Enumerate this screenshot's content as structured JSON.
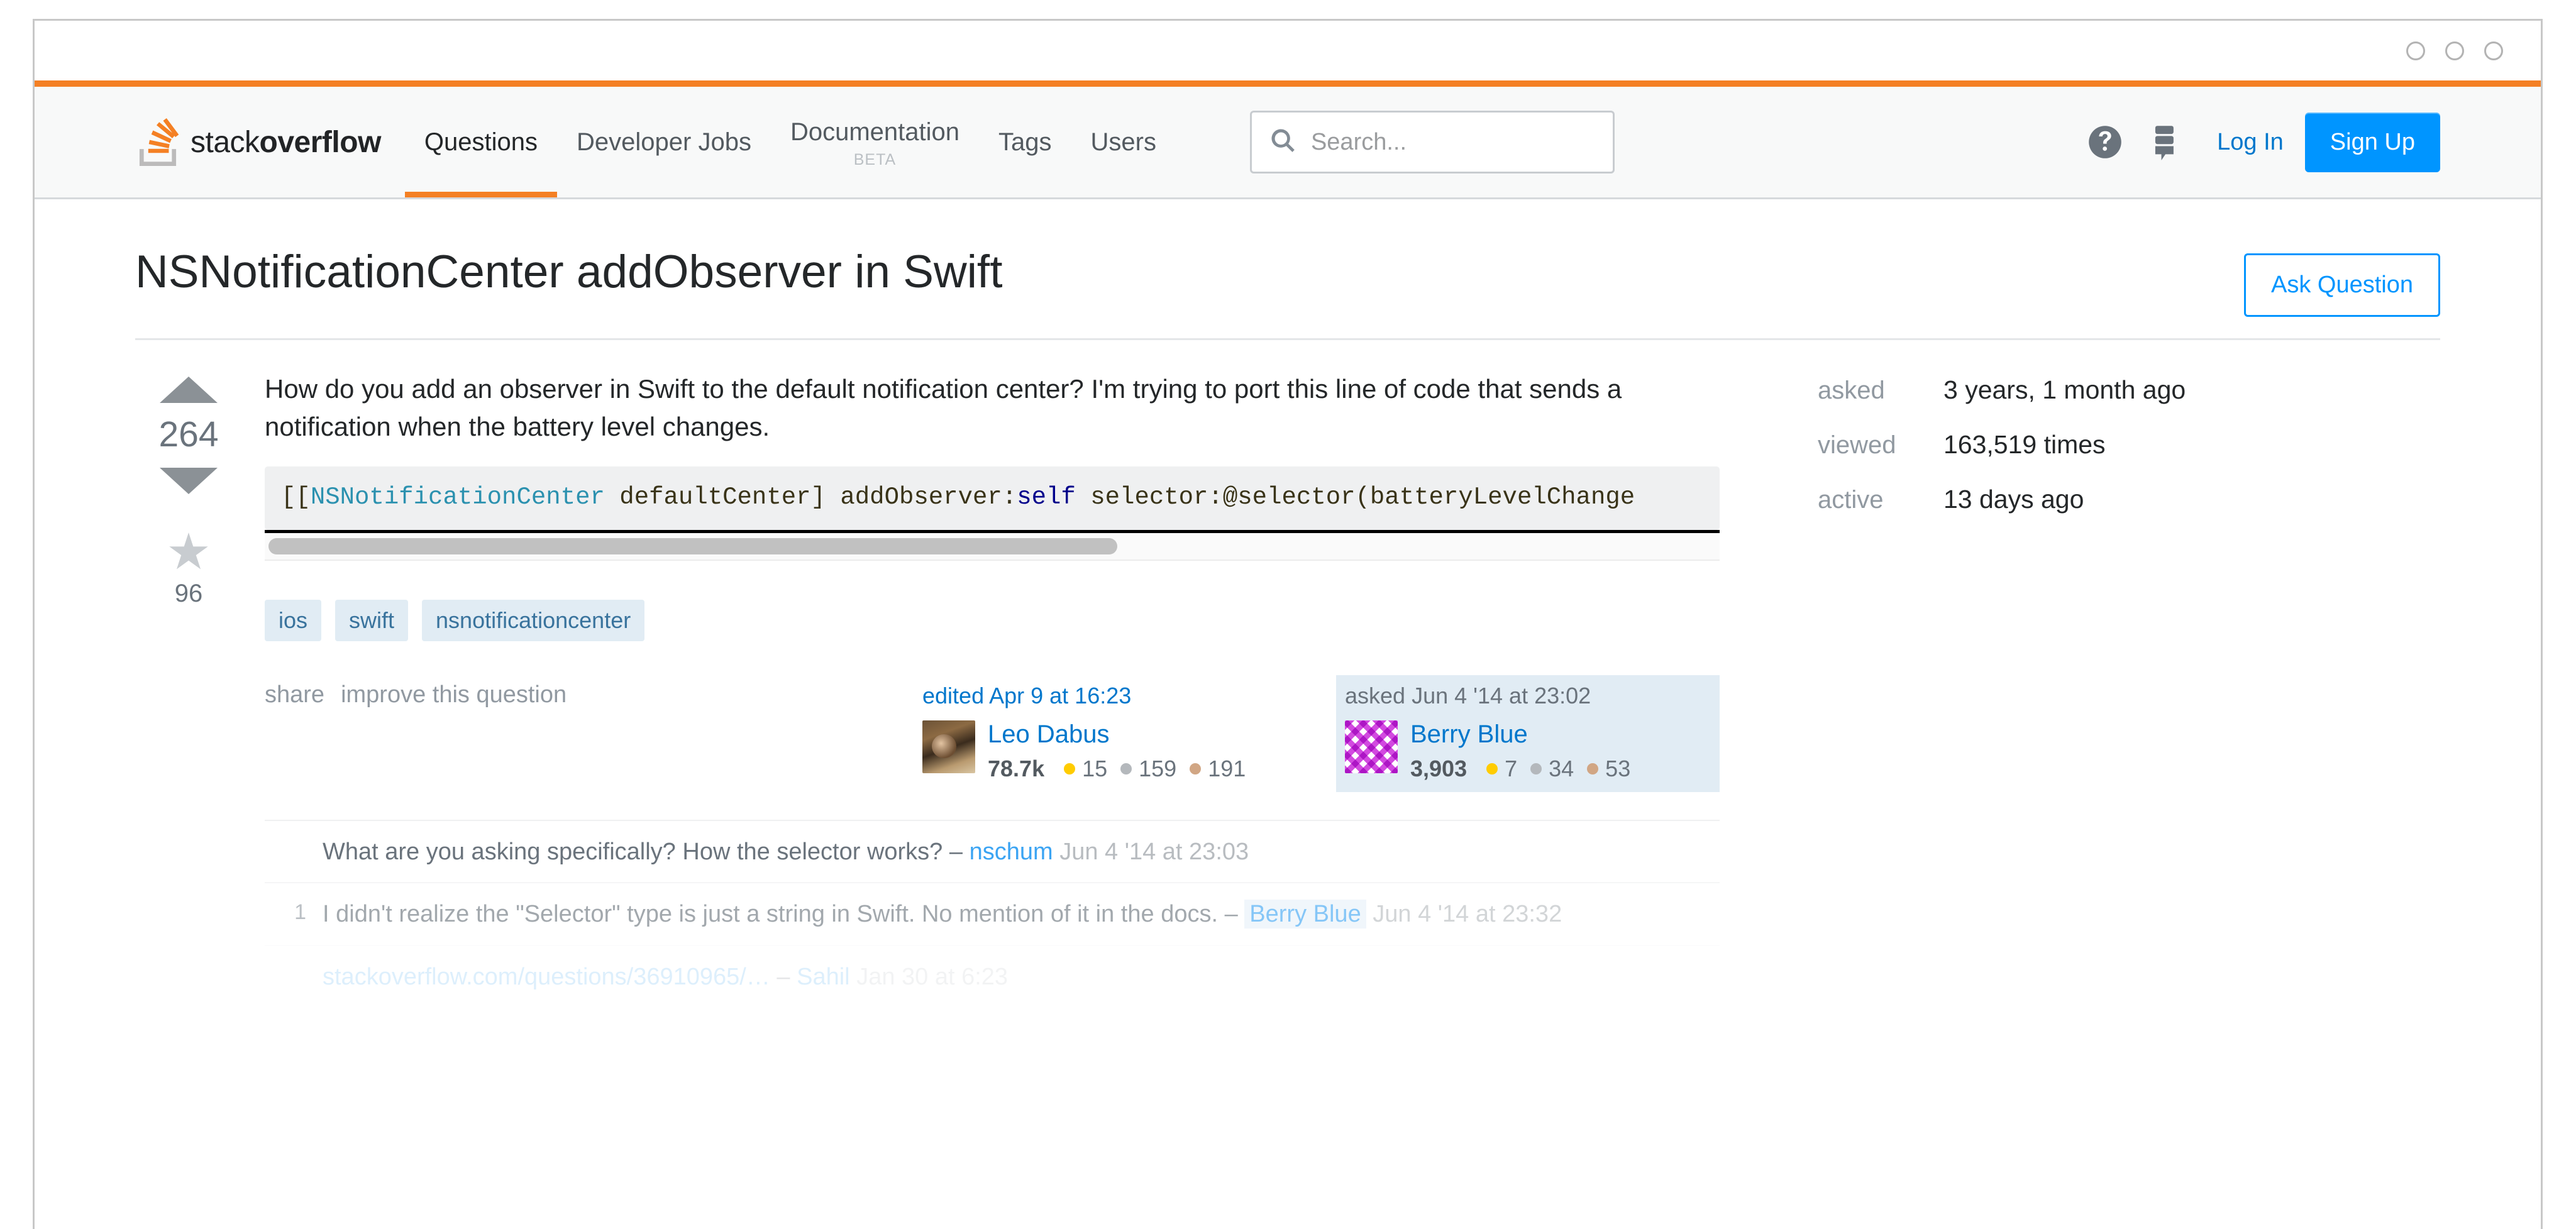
{
  "window": {
    "controls": [
      "minimize-dot",
      "maximize-dot",
      "close-dot"
    ]
  },
  "header": {
    "logo_text_light": "stack",
    "logo_text_bold": "overflow",
    "nav": [
      {
        "label": "Questions",
        "sublabel": "",
        "active": true
      },
      {
        "label": "Developer Jobs",
        "sublabel": "",
        "active": false
      },
      {
        "label": "Documentation",
        "sublabel": "BETA",
        "active": false
      },
      {
        "label": "Tags",
        "sublabel": "",
        "active": false
      },
      {
        "label": "Users",
        "sublabel": "",
        "active": false
      }
    ],
    "search": {
      "placeholder": "Search...",
      "value": ""
    },
    "help_icon": "help-circle-icon",
    "inbox_icon": "achievements-icon",
    "login_label": "Log In",
    "signup_label": "Sign Up",
    "accent_color": "#f48024",
    "signup_color": "#0095ff"
  },
  "question": {
    "title": "NSNotificationCenter addObserver in Swift",
    "ask_question_label": "Ask Question",
    "vote_count": "264",
    "favorite_count": "96",
    "body_text": "How do you add an observer in Swift to the default notification center? I'm trying to port this line of code that sends a notification when the battery level changes.",
    "code": {
      "prefix": "[[",
      "type_token": "NSNotificationCenter",
      "middle": " defaultCenter] addObserver:",
      "kw_token": "self",
      "suffix": " selector:@selector(batteryLevelChange"
    },
    "tags": [
      "ios",
      "swift",
      "nsnotificationcenter"
    ],
    "actions": [
      "share",
      "improve this question"
    ],
    "editor_card": {
      "action": "edited Apr 9 at 16:23",
      "name": "Leo Dabus",
      "reputation": "78.7k",
      "gold": "15",
      "silver": "159",
      "bronze": "191"
    },
    "owner_card": {
      "action": "asked Jun 4 '14 at 23:02",
      "name": "Berry Blue",
      "reputation": "3,903",
      "gold": "7",
      "silver": "34",
      "bronze": "53"
    }
  },
  "comments": [
    {
      "score": "",
      "text": "What are you asking specifically? How the selector works?",
      "dash": "–",
      "user": "nschum",
      "user_is_owner": false,
      "date": "Jun 4 '14 at 23:03",
      "fade": "0"
    },
    {
      "score": "1",
      "text": "I didn't realize the \"Selector\" type is just a string in Swift. No mention of it in the docs.",
      "dash": "–",
      "user": "Berry Blue",
      "user_is_owner": true,
      "date": "Jun 4 '14 at 23:32",
      "fade": "1"
    },
    {
      "score": "",
      "text": "stackoverflow.com/questions/36910965/…",
      "dash": "–",
      "user": "Sahil",
      "user_is_owner": false,
      "date": "Jan 30 at 6:23",
      "fade": "2"
    }
  ],
  "stats": [
    {
      "label": "asked",
      "value": "3 years, 1 month ago"
    },
    {
      "label": "viewed",
      "value": "163,519 times"
    },
    {
      "label": "active",
      "value": "13 days ago"
    }
  ]
}
